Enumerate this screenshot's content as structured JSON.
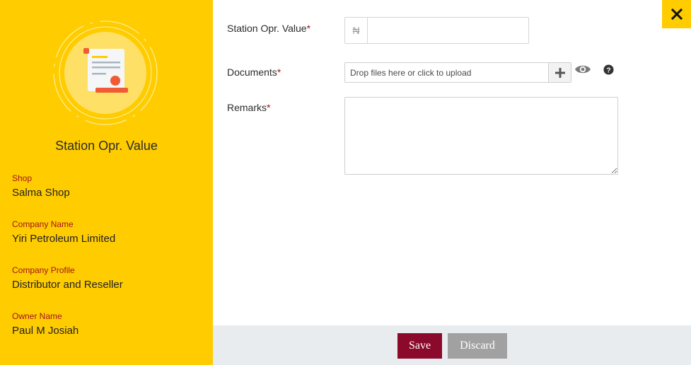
{
  "sidebar": {
    "title": "Station Opr. Value",
    "fields": [
      {
        "label": "Shop",
        "value": "Salma Shop"
      },
      {
        "label": "Company Name",
        "value": "Yiri Petroleum Limited"
      },
      {
        "label": "Company Profile",
        "value": "Distributor and Reseller"
      },
      {
        "label": "Owner Name",
        "value": "Paul M Josiah"
      }
    ]
  },
  "form": {
    "amount": {
      "label": "Station Opr. Value",
      "required_mark": "*",
      "currency_symbol": "₦",
      "value": ""
    },
    "documents": {
      "label": "Documents",
      "required_mark": "*",
      "placeholder": "Drop files here or click to upload"
    },
    "remarks": {
      "label": "Remarks",
      "required_mark": "*",
      "value": ""
    }
  },
  "actions": {
    "save_label": "Save",
    "discard_label": "Discard"
  },
  "colors": {
    "sidebar_bg": "#ffcc00",
    "required": "#a0151c",
    "save": "#8b0a2b",
    "discard": "#a1a1a1",
    "footer_bg": "#e8ecef"
  },
  "icons": {
    "emblem": "document-certificate-icon",
    "add": "plus-icon",
    "view": "eye-icon",
    "help": "question-icon",
    "close": "close-icon"
  }
}
